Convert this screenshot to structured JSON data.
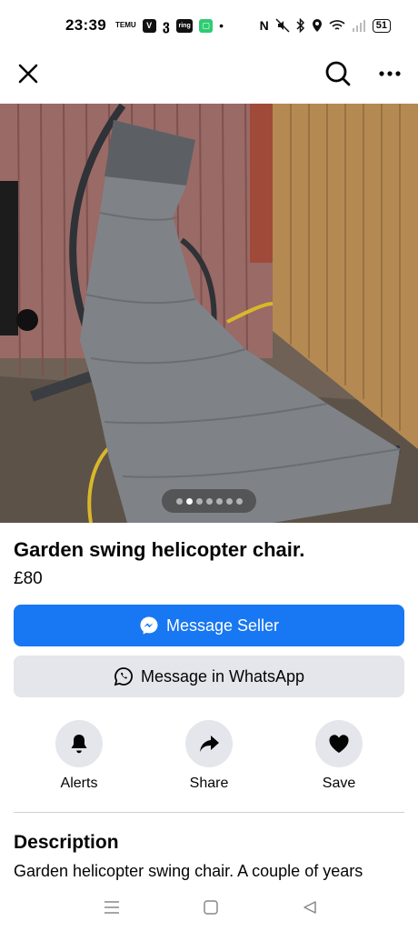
{
  "status_bar": {
    "time": "23:39",
    "left_icons": [
      "temu-icon",
      "v-app-icon",
      "threads-icon",
      "ring-icon",
      "green-app-icon",
      "dot-icon"
    ],
    "temu_text": "TEMU",
    "ring_text": "ring",
    "right_icons": [
      "nfc-icon",
      "mute-icon",
      "bluetooth-icon",
      "location-icon",
      "wifi-icon",
      "signal-icon"
    ],
    "battery": "51"
  },
  "photo": {
    "carousel_total": 7,
    "carousel_active": 2
  },
  "listing": {
    "title": "Garden swing helicopter chair.",
    "price": "£80"
  },
  "buttons": {
    "message_seller": "Message Seller",
    "message_whatsapp": "Message in WhatsApp"
  },
  "actions": {
    "alerts": "Alerts",
    "share": "Share",
    "save": "Save"
  },
  "description": {
    "heading": "Description",
    "text": "Garden helicopter swing chair. A couple of years"
  },
  "colors": {
    "primary": "#1877f2",
    "secondary_bg": "#e4e6eb"
  }
}
